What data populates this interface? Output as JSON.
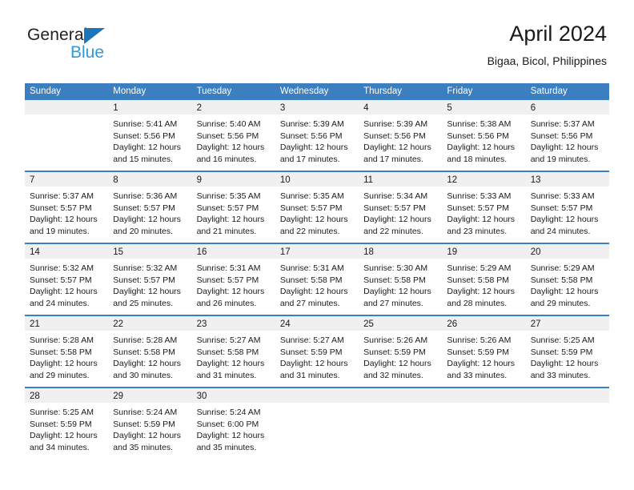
{
  "brand": {
    "line1": "General",
    "line2": "Blue",
    "triangle_color": "#1b75bb",
    "line2_color": "#2e9bd6"
  },
  "header": {
    "title": "April 2024",
    "subtitle": "Bigaa, Bicol, Philippines"
  },
  "theme": {
    "header_blue": "#3c7fc0",
    "daynum_band": "#f0f0f0",
    "text": "#1a1a1a"
  },
  "weekdays": [
    "Sunday",
    "Monday",
    "Tuesday",
    "Wednesday",
    "Thursday",
    "Friday",
    "Saturday"
  ],
  "weeks": [
    [
      {
        "day": "",
        "lines": []
      },
      {
        "day": "1",
        "lines": [
          "Sunrise: 5:41 AM",
          "Sunset: 5:56 PM",
          "Daylight: 12 hours",
          "and 15 minutes."
        ]
      },
      {
        "day": "2",
        "lines": [
          "Sunrise: 5:40 AM",
          "Sunset: 5:56 PM",
          "Daylight: 12 hours",
          "and 16 minutes."
        ]
      },
      {
        "day": "3",
        "lines": [
          "Sunrise: 5:39 AM",
          "Sunset: 5:56 PM",
          "Daylight: 12 hours",
          "and 17 minutes."
        ]
      },
      {
        "day": "4",
        "lines": [
          "Sunrise: 5:39 AM",
          "Sunset: 5:56 PM",
          "Daylight: 12 hours",
          "and 17 minutes."
        ]
      },
      {
        "day": "5",
        "lines": [
          "Sunrise: 5:38 AM",
          "Sunset: 5:56 PM",
          "Daylight: 12 hours",
          "and 18 minutes."
        ]
      },
      {
        "day": "6",
        "lines": [
          "Sunrise: 5:37 AM",
          "Sunset: 5:56 PM",
          "Daylight: 12 hours",
          "and 19 minutes."
        ]
      }
    ],
    [
      {
        "day": "7",
        "lines": [
          "Sunrise: 5:37 AM",
          "Sunset: 5:57 PM",
          "Daylight: 12 hours",
          "and 19 minutes."
        ]
      },
      {
        "day": "8",
        "lines": [
          "Sunrise: 5:36 AM",
          "Sunset: 5:57 PM",
          "Daylight: 12 hours",
          "and 20 minutes."
        ]
      },
      {
        "day": "9",
        "lines": [
          "Sunrise: 5:35 AM",
          "Sunset: 5:57 PM",
          "Daylight: 12 hours",
          "and 21 minutes."
        ]
      },
      {
        "day": "10",
        "lines": [
          "Sunrise: 5:35 AM",
          "Sunset: 5:57 PM",
          "Daylight: 12 hours",
          "and 22 minutes."
        ]
      },
      {
        "day": "11",
        "lines": [
          "Sunrise: 5:34 AM",
          "Sunset: 5:57 PM",
          "Daylight: 12 hours",
          "and 22 minutes."
        ]
      },
      {
        "day": "12",
        "lines": [
          "Sunrise: 5:33 AM",
          "Sunset: 5:57 PM",
          "Daylight: 12 hours",
          "and 23 minutes."
        ]
      },
      {
        "day": "13",
        "lines": [
          "Sunrise: 5:33 AM",
          "Sunset: 5:57 PM",
          "Daylight: 12 hours",
          "and 24 minutes."
        ]
      }
    ],
    [
      {
        "day": "14",
        "lines": [
          "Sunrise: 5:32 AM",
          "Sunset: 5:57 PM",
          "Daylight: 12 hours",
          "and 24 minutes."
        ]
      },
      {
        "day": "15",
        "lines": [
          "Sunrise: 5:32 AM",
          "Sunset: 5:57 PM",
          "Daylight: 12 hours",
          "and 25 minutes."
        ]
      },
      {
        "day": "16",
        "lines": [
          "Sunrise: 5:31 AM",
          "Sunset: 5:57 PM",
          "Daylight: 12 hours",
          "and 26 minutes."
        ]
      },
      {
        "day": "17",
        "lines": [
          "Sunrise: 5:31 AM",
          "Sunset: 5:58 PM",
          "Daylight: 12 hours",
          "and 27 minutes."
        ]
      },
      {
        "day": "18",
        "lines": [
          "Sunrise: 5:30 AM",
          "Sunset: 5:58 PM",
          "Daylight: 12 hours",
          "and 27 minutes."
        ]
      },
      {
        "day": "19",
        "lines": [
          "Sunrise: 5:29 AM",
          "Sunset: 5:58 PM",
          "Daylight: 12 hours",
          "and 28 minutes."
        ]
      },
      {
        "day": "20",
        "lines": [
          "Sunrise: 5:29 AM",
          "Sunset: 5:58 PM",
          "Daylight: 12 hours",
          "and 29 minutes."
        ]
      }
    ],
    [
      {
        "day": "21",
        "lines": [
          "Sunrise: 5:28 AM",
          "Sunset: 5:58 PM",
          "Daylight: 12 hours",
          "and 29 minutes."
        ]
      },
      {
        "day": "22",
        "lines": [
          "Sunrise: 5:28 AM",
          "Sunset: 5:58 PM",
          "Daylight: 12 hours",
          "and 30 minutes."
        ]
      },
      {
        "day": "23",
        "lines": [
          "Sunrise: 5:27 AM",
          "Sunset: 5:58 PM",
          "Daylight: 12 hours",
          "and 31 minutes."
        ]
      },
      {
        "day": "24",
        "lines": [
          "Sunrise: 5:27 AM",
          "Sunset: 5:59 PM",
          "Daylight: 12 hours",
          "and 31 minutes."
        ]
      },
      {
        "day": "25",
        "lines": [
          "Sunrise: 5:26 AM",
          "Sunset: 5:59 PM",
          "Daylight: 12 hours",
          "and 32 minutes."
        ]
      },
      {
        "day": "26",
        "lines": [
          "Sunrise: 5:26 AM",
          "Sunset: 5:59 PM",
          "Daylight: 12 hours",
          "and 33 minutes."
        ]
      },
      {
        "day": "27",
        "lines": [
          "Sunrise: 5:25 AM",
          "Sunset: 5:59 PM",
          "Daylight: 12 hours",
          "and 33 minutes."
        ]
      }
    ],
    [
      {
        "day": "28",
        "lines": [
          "Sunrise: 5:25 AM",
          "Sunset: 5:59 PM",
          "Daylight: 12 hours",
          "and 34 minutes."
        ]
      },
      {
        "day": "29",
        "lines": [
          "Sunrise: 5:24 AM",
          "Sunset: 5:59 PM",
          "Daylight: 12 hours",
          "and 35 minutes."
        ]
      },
      {
        "day": "30",
        "lines": [
          "Sunrise: 5:24 AM",
          "Sunset: 6:00 PM",
          "Daylight: 12 hours",
          "and 35 minutes."
        ]
      },
      {
        "day": "",
        "lines": []
      },
      {
        "day": "",
        "lines": []
      },
      {
        "day": "",
        "lines": []
      },
      {
        "day": "",
        "lines": []
      }
    ]
  ]
}
